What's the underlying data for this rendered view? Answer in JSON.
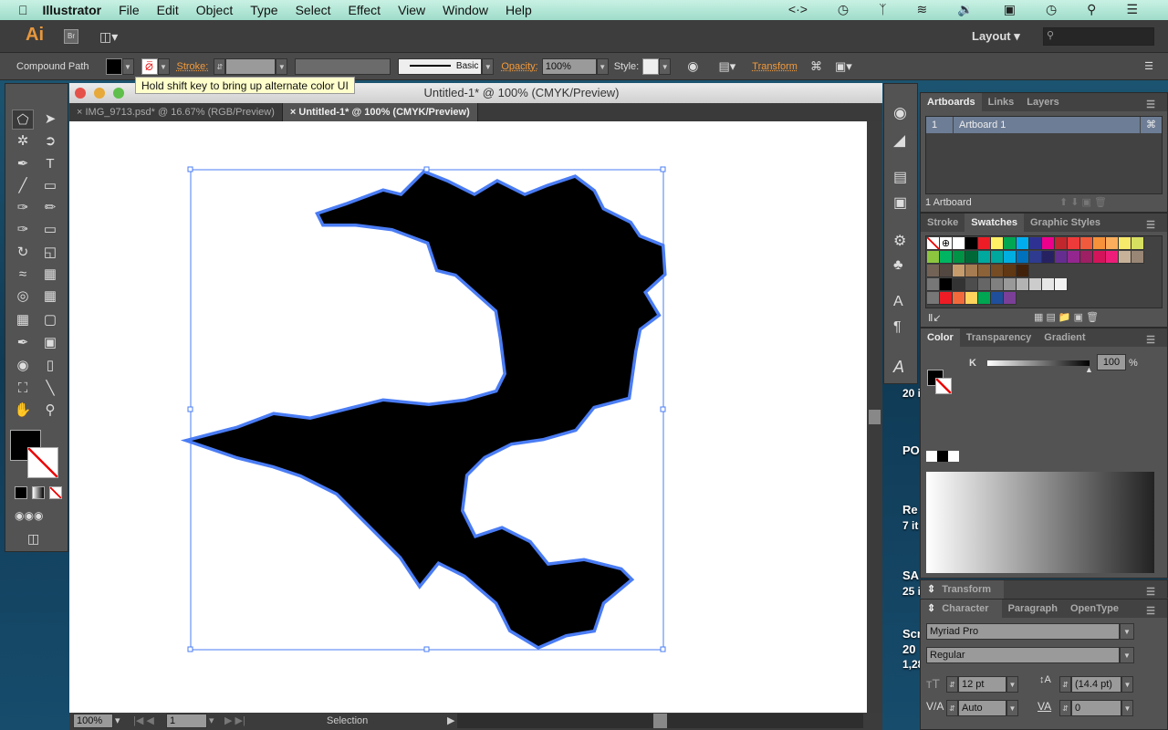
{
  "menubar": {
    "apple": "",
    "app": "Illustrator",
    "items": [
      "File",
      "Edit",
      "Object",
      "Type",
      "Select",
      "Effect",
      "View",
      "Window",
      "Help"
    ]
  },
  "appbar": {
    "logo": "Ai",
    "bridge": "Br",
    "workspace": "Layout",
    "search_placeholder": ""
  },
  "control": {
    "selection_type": "Compound Path",
    "stroke_label": "Stroke:",
    "brush": "Basic",
    "opacity_label": "Opacity:",
    "opacity": "100%",
    "style_label": "Style:",
    "transform": "Transform",
    "fill_color": "#000000"
  },
  "tooltip": "Hold shift key to bring up alternate color UI",
  "document": {
    "title": "Untitled-1* @ 100% (CMYK/Preview)",
    "tabs": [
      {
        "label": "IMG_9713.psd* @ 16.67% (RGB/Preview)",
        "active": false
      },
      {
        "label": "Untitled-1* @ 100% (CMYK/Preview)",
        "active": true
      }
    ],
    "shape_fill": "#000000",
    "selection_color": "#4a7cf4"
  },
  "status": {
    "zoom": "100%",
    "artboard": "1",
    "tool": "Selection"
  },
  "artboards_panel": {
    "tabs": [
      "Artboards",
      "Links",
      "Layers"
    ],
    "rows": [
      {
        "num": "1",
        "name": "Artboard 1"
      }
    ],
    "count": "1 Artboard"
  },
  "swatches_panel": {
    "tabs": [
      "Stroke",
      "Swatches",
      "Graphic Styles"
    ],
    "rows": [
      [
        "none",
        "registration",
        "#ffffff",
        "#000000",
        "#ee1c25",
        "#fff066",
        "#00a651",
        "#00aeef",
        "#2e3192",
        "#ec008c",
        "#c1272d",
        "#ed3a3a",
        "#f15a3c",
        "#f7923a",
        "#fbae5c",
        "#f7e96a",
        "#d7df61"
      ],
      [
        "#8cc63f",
        "#00b561",
        "#009245",
        "#006837",
        "#00a99d",
        "#00a79d",
        "#00aee0",
        "#0071bc",
        "#2e3b8f",
        "#262262",
        "#662d91",
        "#93278f",
        "#9e1f63",
        "#d4145a",
        "#ed1e79",
        "#c7b299",
        "#998675"
      ],
      [
        "#736357",
        "#534741",
        "#c69c6d",
        "#a67c52",
        "#8c6239",
        "#754c24",
        "#603813",
        "#42210b"
      ],
      [
        "#000000",
        "#333333",
        "#4d4d4d",
        "#666666",
        "#808080",
        "#999999",
        "#b3b3b3",
        "#cccccc",
        "#e6e6e6",
        "#f2f2f2"
      ],
      [
        "#ee1c25",
        "#f26a3c",
        "#ffd35c",
        "#00a651",
        "#1f4e9a",
        "#7b3f98"
      ]
    ]
  },
  "color_panel": {
    "tabs": [
      "Color",
      "Transparency",
      "Gradient"
    ],
    "channel": "K",
    "value": "100",
    "unit": "%"
  },
  "transform_panel": {
    "title": "Transform"
  },
  "character_panel": {
    "tabs": [
      "Character",
      "Paragraph",
      "OpenType"
    ],
    "font": "Myriad Pro",
    "style": "Regular",
    "size": "12 pt",
    "leading": "(14.4 pt)",
    "kerning": "Auto",
    "tracking": "0"
  },
  "desktop": {
    "items": [
      "20 i",
      "PO",
      "Re",
      "7 it",
      "SA",
      "25 i",
      "Scr",
      "20",
      "1,28"
    ]
  }
}
